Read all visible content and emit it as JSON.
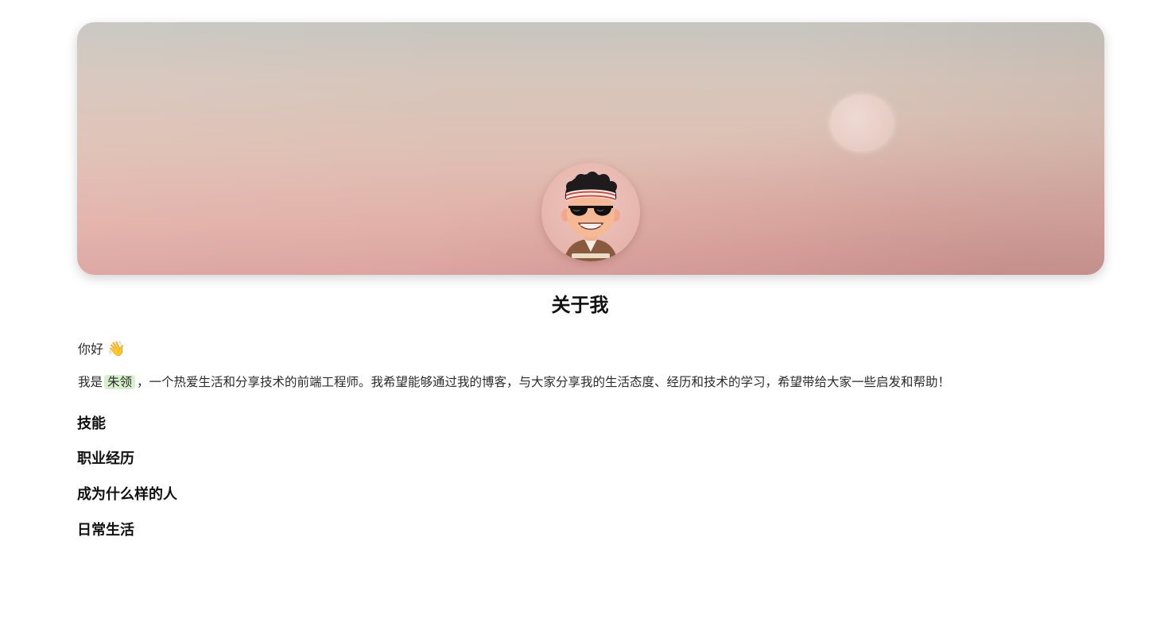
{
  "banner": {
    "avatar_alt": "avatar"
  },
  "page": {
    "title": "关于我"
  },
  "about": {
    "greeting": "你好",
    "greeting_emoji": "👋",
    "intro_prefix": "我是",
    "name": "朱领",
    "intro_suffix": "，一个热爱生活和分享技术的前端工程师。我希望能够通过我的博客，与大家分享我的生活态度、经历和技术的学习，希望带给大家一些启发和帮助！"
  },
  "sections": [
    {
      "title": "技能"
    },
    {
      "title": "职业经历"
    },
    {
      "title": "成为什么样的人"
    },
    {
      "title": "日常生活"
    }
  ],
  "colors": {
    "highlight": "#d7efcb",
    "heading": "#111111",
    "text": "#2b2b2b"
  }
}
